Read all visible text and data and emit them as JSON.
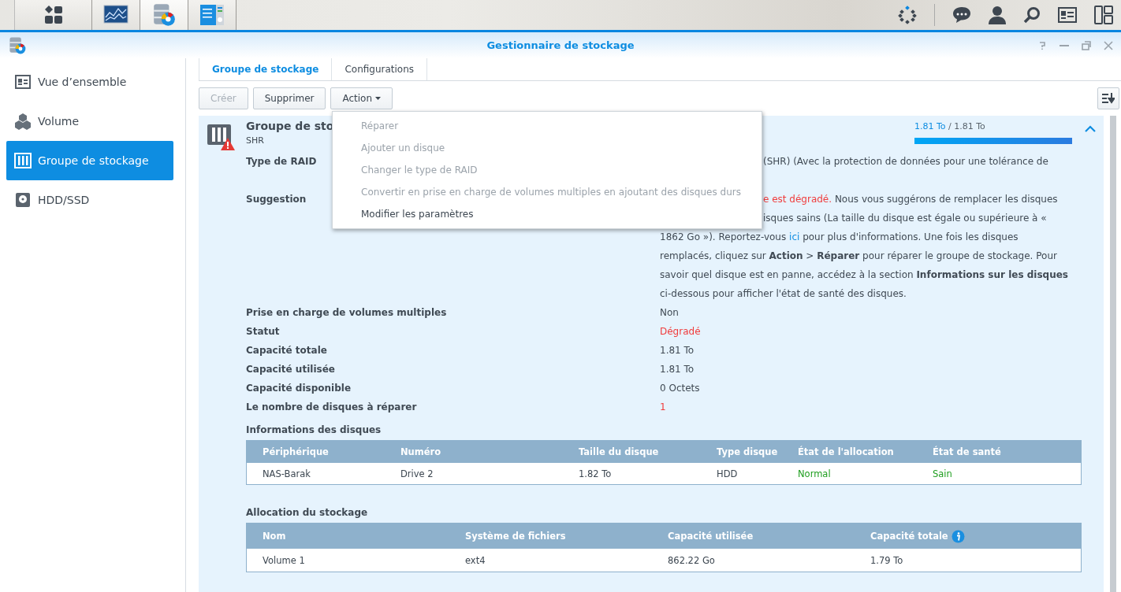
{
  "window": {
    "title": "Gestionnaire de stockage"
  },
  "sidebar": {
    "items": [
      {
        "label": "Vue d’ensemble",
        "kind": "overview",
        "selected": false
      },
      {
        "label": "Volume",
        "kind": "volume",
        "selected": false
      },
      {
        "label": "Groupe de stockage",
        "kind": "pool",
        "selected": true
      },
      {
        "label": "HDD/SSD",
        "kind": "disk",
        "selected": false
      }
    ]
  },
  "tabs": [
    {
      "label": "Groupe de stockage",
      "selected": true
    },
    {
      "label": "Configurations",
      "selected": false
    }
  ],
  "toolbar": {
    "buttons": [
      {
        "label": "Créer",
        "kind": "plain",
        "disabled": true
      },
      {
        "label": "Supprimer",
        "kind": "plain",
        "disabled": false
      },
      {
        "label": "Action",
        "kind": "dropdown",
        "disabled": false
      }
    ]
  },
  "action_menu": {
    "items": [
      {
        "label": "Réparer",
        "disabled": true
      },
      {
        "label": "Ajouter un disque",
        "disabled": true
      },
      {
        "label": "Changer le type de RAID",
        "disabled": true
      },
      {
        "label": "Convertir en prise en charge de volumes multiples en ajoutant des disques durs",
        "disabled": true
      },
      {
        "label": "Modifier les paramètres",
        "disabled": false
      }
    ]
  },
  "pool": {
    "title": "Groupe de sto",
    "subtitle": "SHR",
    "warning": true,
    "expanded": true,
    "usage": {
      "used": "1.81 To",
      "separator": "/",
      "total": "1.81 To",
      "level": 1
    },
    "details": [
      {
        "label": "Type de RAID",
        "partial_lines": [
          [
            {
              "kind": "plain",
              "text": "(SHR) (Avec la protection de données pour une tolérance de"
            }
          ]
        ]
      },
      {
        "label": "Suggestion",
        "partial_lines": [
          [
            {
              "kind": "alert",
              "text": "e est dégradé."
            },
            {
              "kind": "plain",
              "text": " Nous vous suggérons de remplacer les disques"
            }
          ],
          [
            {
              "kind": "plain",
              "text": "isques sains (La taille du disque est égale ou supérieure à «"
            }
          ]
        ],
        "lines": [
          [
            {
              "kind": "plain",
              "text": "1862 Go »). Reportez-vous "
            },
            {
              "kind": "link",
              "text": "ici"
            },
            {
              "kind": "plain",
              "text": " pour plus d'informations. Une fois les disques"
            }
          ],
          [
            {
              "kind": "plain",
              "text": "remplacés, cliquez sur **Action** > **Réparer** pour réparer le groupe de stockage. Pour"
            }
          ],
          [
            {
              "kind": "plain",
              "text": "savoir quel disque est en panne, accédez à la section **Informations sur les disques**"
            }
          ],
          [
            {
              "kind": "plain",
              "text": "ci-dessous pour afficher l'état de santé des disques."
            }
          ]
        ]
      },
      {
        "label": "Prise en charge de volumes multiples",
        "lines": [
          [
            {
              "kind": "plain",
              "text": "Non"
            }
          ]
        ]
      },
      {
        "label": "Statut",
        "lines": [
          [
            {
              "kind": "alert",
              "text": "Dégradé"
            }
          ]
        ]
      },
      {
        "label": "Capacité totale",
        "lines": [
          [
            {
              "kind": "plain",
              "text": "1.81 To"
            }
          ]
        ]
      },
      {
        "label": "Capacité utilisée",
        "lines": [
          [
            {
              "kind": "plain",
              "text": "1.81 To"
            }
          ]
        ]
      },
      {
        "label": "Capacité disponible",
        "lines": [
          [
            {
              "kind": "plain",
              "text": "0 Octets"
            }
          ]
        ]
      },
      {
        "label": "Le nombre de disques à réparer",
        "lines": [
          [
            {
              "kind": "alert",
              "text": "1"
            }
          ]
        ]
      }
    ],
    "tables": [
      {
        "title": "Informations des disques",
        "columns": [
          {
            "label": "Périphérique"
          },
          {
            "label": "Numéro"
          },
          {
            "label": "Taille du disque"
          },
          {
            "label": "Type disque"
          },
          {
            "label": "État de l'allocation"
          },
          {
            "label": "État de santé"
          }
        ],
        "rows": [
          [
            {
              "text": "NAS-Barak",
              "kind": "plain"
            },
            {
              "text": "Drive 2",
              "kind": "plain"
            },
            {
              "text": "1.82 To",
              "kind": "plain"
            },
            {
              "text": "HDD",
              "kind": "plain"
            },
            {
              "text": "Normal",
              "kind": "ok"
            },
            {
              "text": "Sain",
              "kind": "ok"
            }
          ]
        ]
      },
      {
        "title": "Allocation du stockage",
        "columns": [
          {
            "label": "Nom"
          },
          {
            "label": "Système de fichiers"
          },
          {
            "label": "Capacité utilisée"
          },
          {
            "label": "Capacité totale",
            "info": true
          }
        ],
        "rows": [
          [
            {
              "text": "Volume 1",
              "kind": "plain"
            },
            {
              "text": "ext4",
              "kind": "plain"
            },
            {
              "text": "862.22 Go",
              "kind": "plain"
            },
            {
              "text": "1.79 To",
              "kind": "plain"
            }
          ]
        ]
      }
    ]
  }
}
